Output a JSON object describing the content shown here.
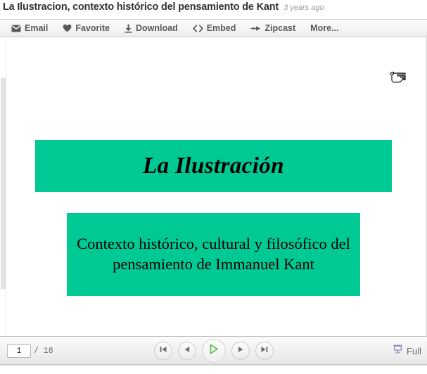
{
  "header": {
    "title": "La Ilustracion, contexto histórico del pensamiento de Kant",
    "age": "3 years ago"
  },
  "toolbar": {
    "items": [
      {
        "label": "Email",
        "icon": "envelope-icon"
      },
      {
        "label": "Favorite",
        "icon": "heart-icon"
      },
      {
        "label": "Download",
        "icon": "download-arrow-icon"
      },
      {
        "label": "Embed",
        "icon": "code-brackets-icon"
      },
      {
        "label": "Zipcast",
        "icon": "zipcast-arrow-icon"
      },
      {
        "label": "More...",
        "icon": "none"
      }
    ]
  },
  "slide": {
    "title": "La Ilustración",
    "subtitle": "Contexto histórico, cultural y filosófico del pensamiento de Immanuel Kant",
    "box_color": "#00c994",
    "text_color": "#000000"
  },
  "cursor": {
    "type": "pointing-hand-cursor"
  },
  "controls": {
    "current_page": "1",
    "page_separator": "/ 18",
    "total_pages": "18",
    "buttons": [
      {
        "name": "first-slide-button",
        "icon": "skip-back-icon"
      },
      {
        "name": "previous-slide-button",
        "icon": "previous-icon"
      },
      {
        "name": "play-button",
        "icon": "play-icon"
      },
      {
        "name": "next-slide-button",
        "icon": "next-icon"
      },
      {
        "name": "last-slide-button",
        "icon": "skip-forward-icon"
      }
    ],
    "fullscreen_label": "Full",
    "fullscreen_icon": "projector-screen-icon",
    "play_accent_color": "#5fbf4a"
  }
}
